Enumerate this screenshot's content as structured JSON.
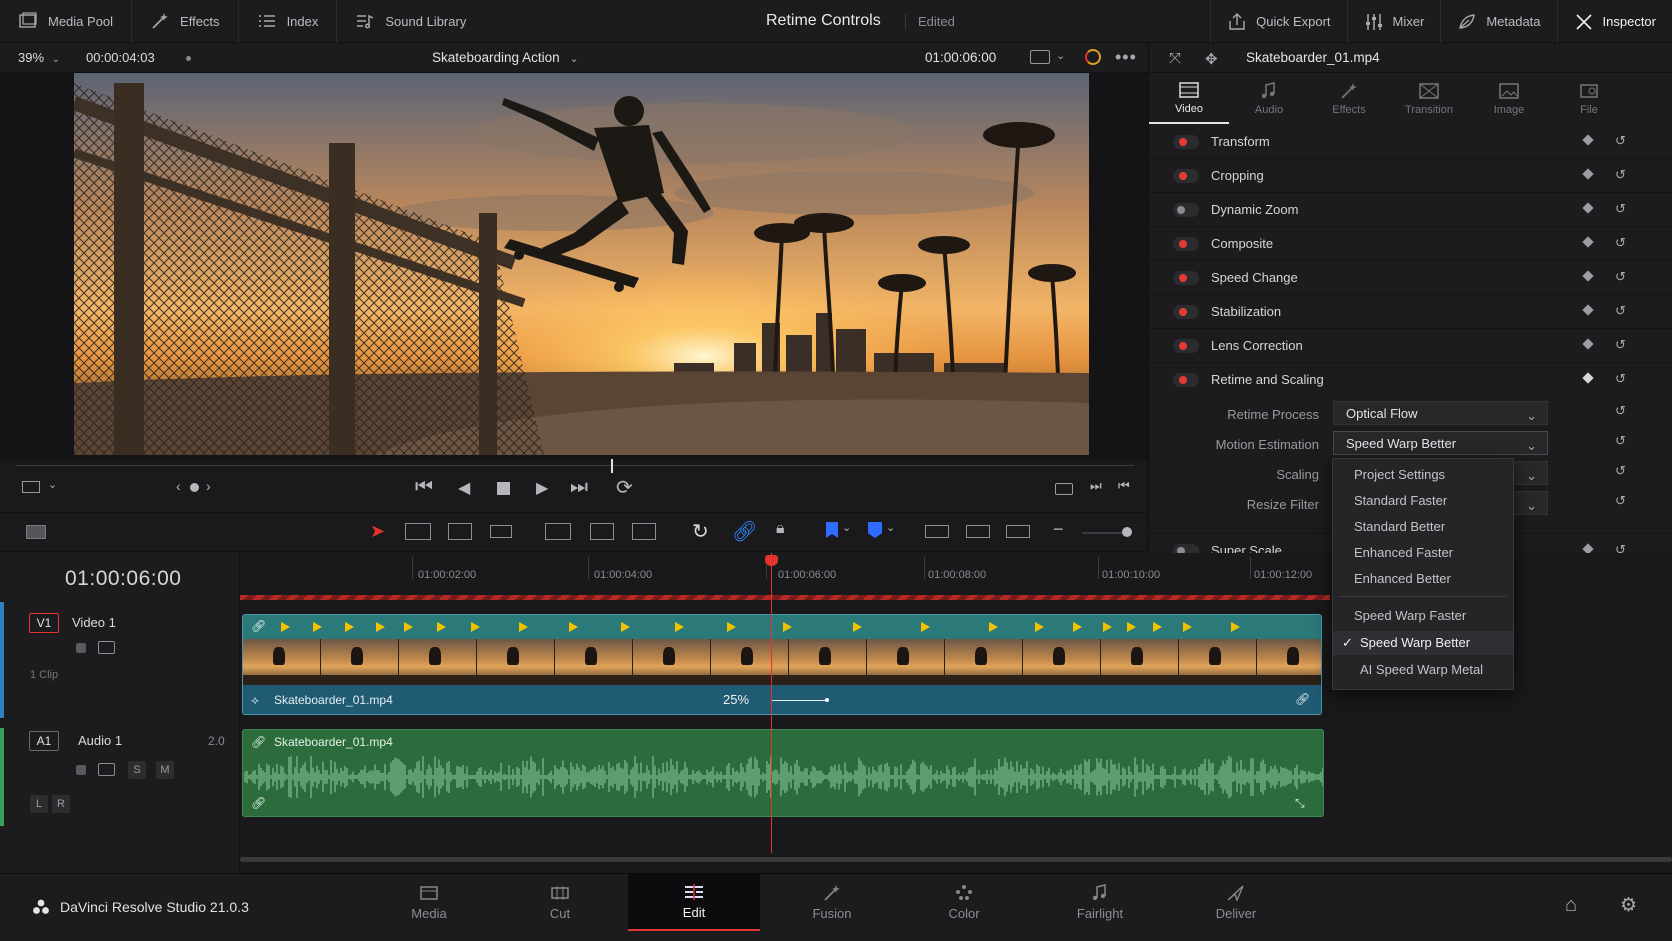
{
  "topbar": {
    "left_items": [
      {
        "label": "Media Pool",
        "icon": "media-pool-icon"
      },
      {
        "label": "Effects",
        "icon": "effects-wand-icon"
      },
      {
        "label": "Index",
        "icon": "index-list-icon"
      },
      {
        "label": "Sound Library",
        "icon": "sound-library-icon"
      }
    ],
    "title": "Retime Controls",
    "status": "Edited",
    "right_items": [
      {
        "label": "Quick Export",
        "icon": "export-icon"
      },
      {
        "label": "Mixer",
        "icon": "mixer-icon"
      },
      {
        "label": "Metadata",
        "icon": "metadata-icon"
      },
      {
        "label": "Inspector",
        "icon": "inspector-icon"
      }
    ]
  },
  "viewer": {
    "zoom": "39%",
    "timecode_left": "00:00:04:03",
    "clip_title": "Skateboarding Action",
    "timecode_right": "01:00:06:00"
  },
  "inspector": {
    "file_name": "Skateboarder_01.mp4",
    "tabs": [
      "Video",
      "Audio",
      "Effects",
      "Transition",
      "Image",
      "File"
    ],
    "active_tab": "Video",
    "sections": [
      {
        "label": "Transform",
        "on": true
      },
      {
        "label": "Cropping",
        "on": true
      },
      {
        "label": "Dynamic Zoom",
        "on": false
      },
      {
        "label": "Composite",
        "on": true
      },
      {
        "label": "Speed Change",
        "on": true
      },
      {
        "label": "Stabilization",
        "on": true
      },
      {
        "label": "Lens Correction",
        "on": true
      },
      {
        "label": "Retime and Scaling",
        "on": true
      }
    ],
    "retime": {
      "retime_process_label": "Retime Process",
      "retime_process_value": "Optical Flow",
      "motion_estimation_label": "Motion Estimation",
      "motion_estimation_value": "Speed Warp Better",
      "scaling_label": "Scaling",
      "resize_filter_label": "Resize Filter"
    },
    "super_scale": {
      "label": "Super Scale",
      "on": false
    }
  },
  "dropdown": {
    "options": [
      "Project Settings",
      "Standard Faster",
      "Standard Better",
      "Enhanced Faster",
      "Enhanced Better",
      "Speed Warp Faster",
      "Speed Warp Better",
      "AI Speed Warp Metal"
    ],
    "selected": "Speed Warp Better"
  },
  "timeline": {
    "timecode": "01:00:06:00",
    "ruler": [
      "01:00:02:00",
      "01:00:04:00",
      "01:00:06:00",
      "01:00:08:00",
      "01:00:10:00",
      "01:00:12:00"
    ],
    "video_track": {
      "badge": "V1",
      "name": "Video 1",
      "clips": "1 Clip",
      "clip_name": "Skateboarder_01.mp4",
      "speed": "25%"
    },
    "audio_track": {
      "badge": "A1",
      "name": "Audio 1",
      "channels": "2.0",
      "clip_name": "Skateboarder_01.mp4",
      "solo": "S",
      "mute": "M",
      "left": "L",
      "right": "R"
    }
  },
  "bottom": {
    "brand": "DaVinci Resolve Studio 21.0.3",
    "pages": [
      "Media",
      "Cut",
      "Edit",
      "Fusion",
      "Color",
      "Fairlight",
      "Deliver"
    ],
    "active_page": "Edit"
  },
  "colors": {
    "accent_red": "#e2332c",
    "video_clip": "#2a6b82",
    "audio_clip": "#2c6b3c",
    "marker_yellow": "#f2c200"
  }
}
